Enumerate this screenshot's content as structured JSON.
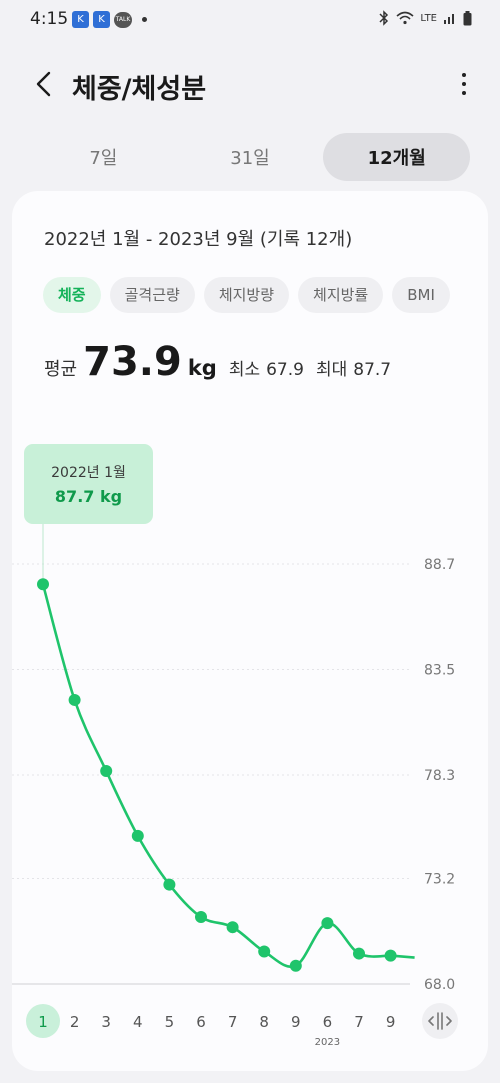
{
  "status_bar": {
    "time": "4:15",
    "notif_badge": "K",
    "talk_label": "TALK",
    "network_label": "LTE"
  },
  "header": {
    "title": "체중/체성분"
  },
  "tabs": [
    {
      "label": "7일",
      "active": false
    },
    {
      "label": "31일",
      "active": false
    },
    {
      "label": "12개월",
      "active": true
    }
  ],
  "summary": {
    "range": "2022년 1월 - 2023년 9월 (기록 12개)",
    "avg_label": "평균",
    "avg_value": "73.9",
    "unit": "kg",
    "min_label": "최소",
    "min_value": "67.9",
    "max_label": "최대",
    "max_value": "87.7"
  },
  "chips": [
    {
      "label": "체중",
      "active": true
    },
    {
      "label": "골격근량",
      "active": false
    },
    {
      "label": "체지방량",
      "active": false
    },
    {
      "label": "체지방률",
      "active": false
    },
    {
      "label": "BMI",
      "active": false
    }
  ],
  "tooltip": {
    "date": "2022년 1월",
    "value": "87.7 kg"
  },
  "chart_data": {
    "type": "line",
    "categories": [
      "1",
      "2",
      "3",
      "4",
      "5",
      "6",
      "7",
      "8",
      "9",
      "6",
      "7",
      "9"
    ],
    "year_label": "2023",
    "year_label_index": 9,
    "values": [
      87.7,
      82.0,
      78.5,
      75.3,
      72.9,
      71.3,
      70.8,
      69.6,
      68.9,
      71.0,
      69.5,
      69.4
    ],
    "y_ticks": [
      "88.7",
      "83.5",
      "78.3",
      "73.2",
      "68.0"
    ],
    "ylim": [
      68.0,
      88.7
    ],
    "selected_index": 0,
    "color": "#1fc46b",
    "tooltip_color": "#c8f0d8"
  }
}
